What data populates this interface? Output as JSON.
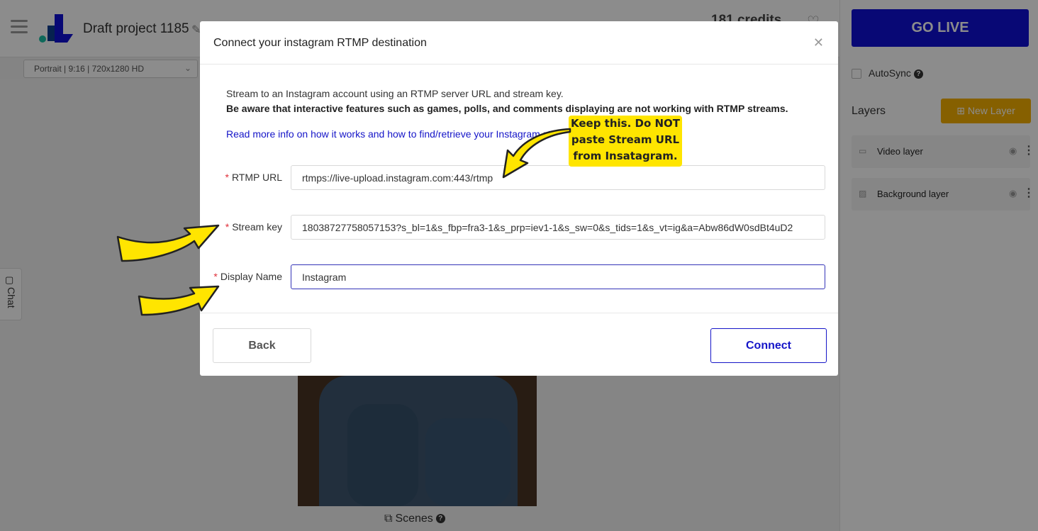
{
  "app": {
    "project_title": "Draft project 1185",
    "credits": "181 credits",
    "format_select": "Portrait | 9:16 | 720x1280 HD",
    "scenes_label": "Scenes",
    "chat_label": "Chat",
    "go_live_label": "GO LIVE",
    "autosync_label": "AutoSync",
    "layers_title": "Layers",
    "new_layer_label": "New Layer",
    "layers": [
      {
        "name": "Video layer",
        "icon": "video-icon"
      },
      {
        "name": "Background layer",
        "icon": "image-icon"
      }
    ],
    "colors": {
      "go_live": "#1010d6",
      "new_layer": "#f5b000"
    }
  },
  "modal": {
    "title": "Connect your instagram RTMP destination",
    "description": "Stream to an Instagram account using an RTMP server URL and stream key.",
    "warning": "Be aware that interactive features such as games, polls, and comments displaying are not working with RTMP streams.",
    "info_link": "Read more info on how it works and how to find/retrieve your Instagram st",
    "fields": {
      "rtmp_url": {
        "label": "RTMP URL",
        "value": "rtmps://live-upload.instagram.com:443/rtmp"
      },
      "stream_key": {
        "label": "Stream key",
        "value": "18038727758057153?s_bl=1&s_fbp=fra3-1&s_prp=iev1-1&s_sw=0&s_tids=1&s_vt=ig&a=Abw86dW0sdBt4uD2"
      },
      "display_name": {
        "label": "Display Name",
        "value": "Instagram"
      }
    },
    "back_label": "Back",
    "connect_label": "Connect",
    "accent_color": "#1515c8"
  },
  "annotation": {
    "callout_lines": [
      "Keep this. Do NOT",
      "paste Stream URL",
      "from Insatagram."
    ],
    "color": "#ffe500"
  }
}
